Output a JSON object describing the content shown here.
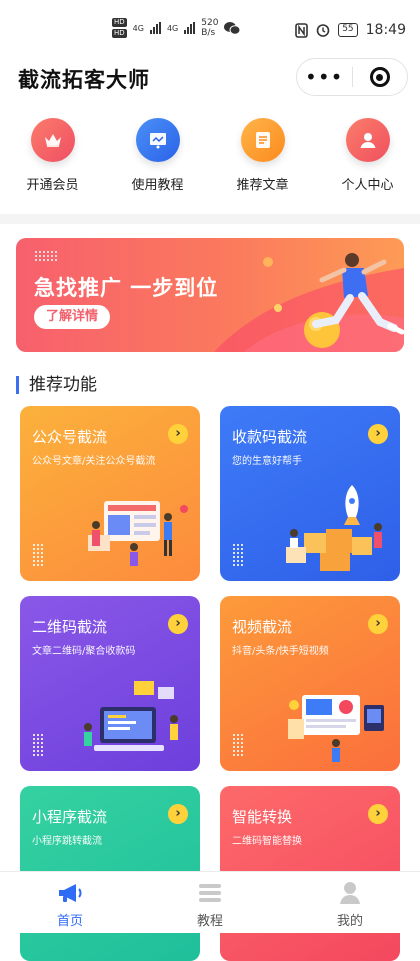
{
  "status_bar": {
    "hd1": "HD",
    "hd2": "HD",
    "net1": "4G",
    "net2": "4G",
    "speed_value": "520",
    "speed_unit": "B/s",
    "battery": "55",
    "time": "18:49"
  },
  "header": {
    "title": "截流拓客大师",
    "more_label": "•••"
  },
  "quick_nav": [
    {
      "label": "开通会员",
      "icon": "crown-icon",
      "color": "#f4616a"
    },
    {
      "label": "使用教程",
      "icon": "book-reader-icon",
      "color": "#3d7bf4"
    },
    {
      "label": "推荐文章",
      "icon": "article-icon",
      "color": "#fd9a2b"
    },
    {
      "label": "个人中心",
      "icon": "user-icon",
      "color": "#f7645f"
    }
  ],
  "banner": {
    "title": "急找推广 一步到位",
    "button": "了解详情"
  },
  "section": {
    "title": "推荐功能"
  },
  "cards": [
    {
      "title": "公众号截流",
      "subtitle": "公众号文章/关注公众号截流",
      "gradient": [
        "#fbb13c",
        "#fd8b3d"
      ]
    },
    {
      "title": "收款码截流",
      "subtitle": "您的生意好帮手",
      "gradient": [
        "#3e7bf7",
        "#2e5fe8"
      ]
    },
    {
      "title": "二维码截流",
      "subtitle": "文章二维码/聚合收款码",
      "gradient": [
        "#8a58e8",
        "#6d3fdc"
      ]
    },
    {
      "title": "视频截流",
      "subtitle": "抖音/头条/快手短视频",
      "gradient": [
        "#fd9a3b",
        "#fb6f3c"
      ]
    },
    {
      "title": "小程序截流",
      "subtitle": "小程序跳转截流",
      "gradient": [
        "#35d1a1",
        "#1fbf9b"
      ]
    },
    {
      "title": "智能转换",
      "subtitle": "二维码智能替换",
      "gradient": [
        "#fd6a6a",
        "#f4485f"
      ]
    }
  ],
  "tabs": [
    {
      "label": "首页",
      "icon": "megaphone-icon",
      "active": true
    },
    {
      "label": "教程",
      "icon": "list-icon",
      "active": false
    },
    {
      "label": "我的",
      "icon": "profile-icon",
      "active": false
    }
  ],
  "colors": {
    "accent": "#2f6cf6",
    "arrow_badge": "#ffd23c"
  }
}
